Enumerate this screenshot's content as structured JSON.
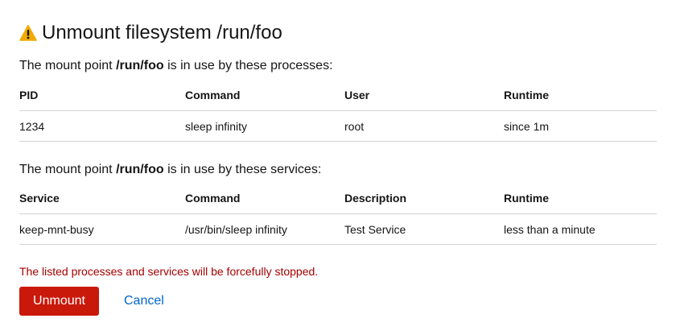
{
  "dialog": {
    "title": "Unmount filesystem /run/foo",
    "title_icon": "warning-triangle-icon",
    "warning_color": "#f0ab00",
    "processes_intro": {
      "prefix": "The mount point ",
      "mount_point": "/run/foo",
      "suffix": " is in use by these processes:"
    },
    "processes_table": {
      "headers": [
        "PID",
        "Command",
        "User",
        "Runtime"
      ],
      "rows": [
        [
          "1234",
          "sleep infinity",
          "root",
          "since 1m"
        ]
      ]
    },
    "services_intro": {
      "prefix": "The mount point ",
      "mount_point": "/run/foo",
      "suffix": " is in use by these services:"
    },
    "services_table": {
      "headers": [
        "Service",
        "Command",
        "Description",
        "Runtime"
      ],
      "rows": [
        [
          "keep-mnt-busy",
          "/usr/bin/sleep infinity",
          "Test Service",
          "less than a minute"
        ]
      ]
    },
    "danger_message": "The listed processes and services will be forcefully stopped.",
    "danger_color": "#c9190b",
    "primary_button": "Unmount",
    "cancel_button": "Cancel"
  }
}
